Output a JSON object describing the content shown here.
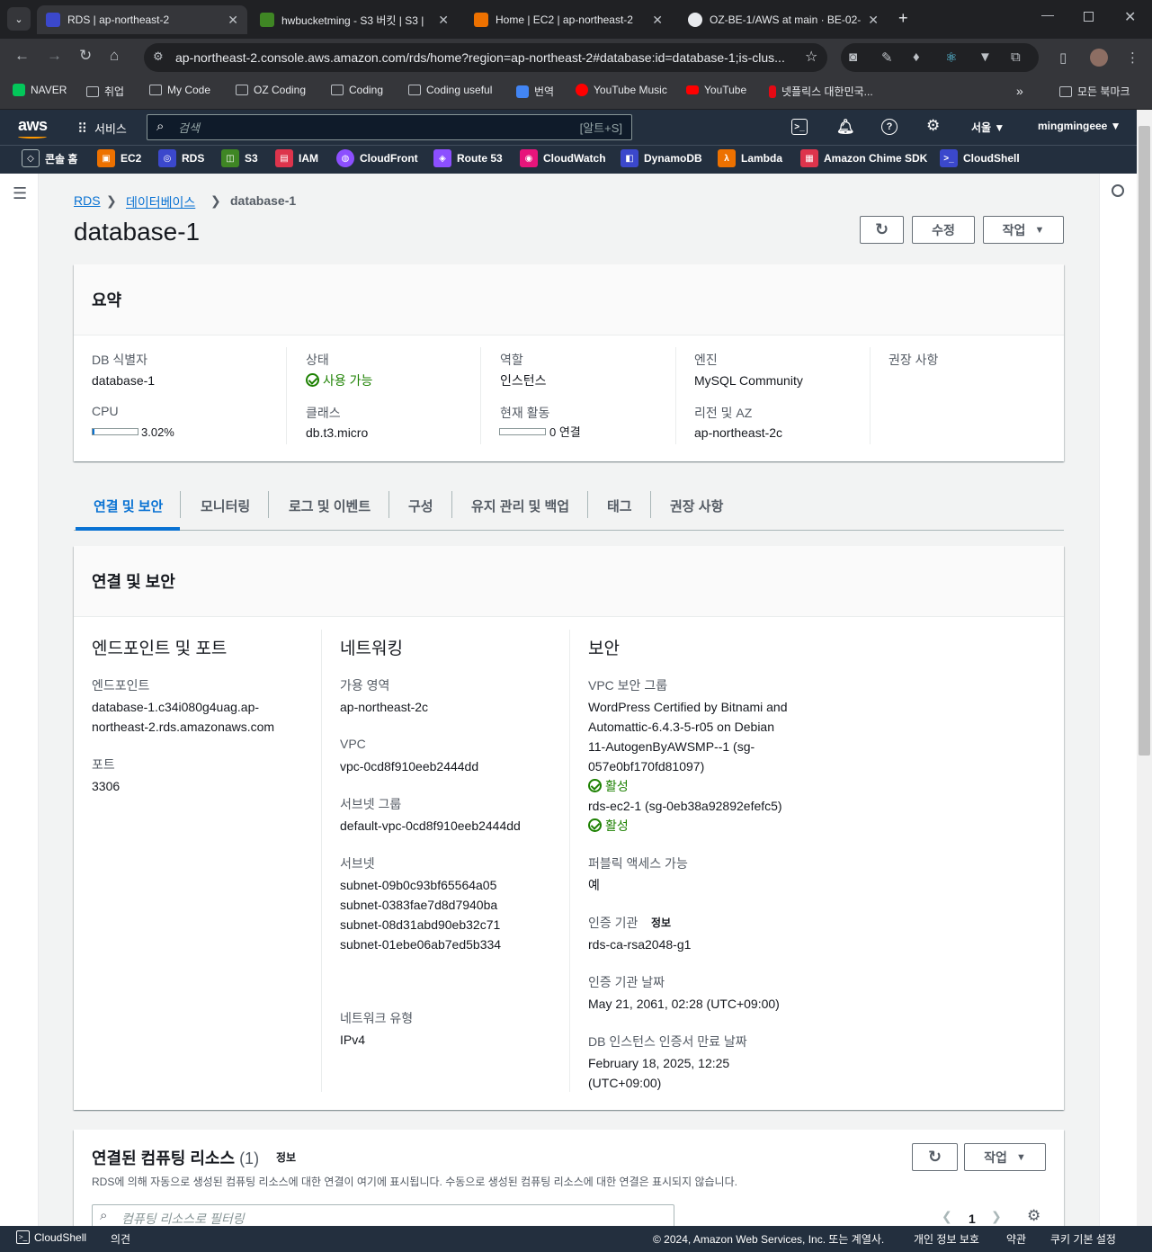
{
  "browser": {
    "tabs": [
      {
        "title": "RDS | ap-northeast-2",
        "active": true,
        "favicon_color": "#3b48cc"
      },
      {
        "title": "hwbucketming - S3 버킷 | S3 |",
        "active": false,
        "favicon_color": "#3f8624"
      },
      {
        "title": "Home | EC2 | ap-northeast-2",
        "active": false,
        "favicon_color": "#ed7100"
      },
      {
        "title": "OZ-BE-1/AWS at main · BE-02-",
        "active": false,
        "favicon_color": "#e8eaed"
      }
    ],
    "url": "ap-northeast-2.console.aws.amazon.com/rds/home?region=ap-northeast-2#database:id=database-1;is-clus...",
    "bookmarks": [
      "NAVER",
      "취업",
      "My Code",
      "OZ Coding",
      "Coding",
      "Coding useful",
      "번역",
      "YouTube Music",
      "YouTube",
      "넷플릭스 대한민국...",
      "모든 북마크"
    ]
  },
  "aws": {
    "services_label": "서비스",
    "search_placeholder": "검색",
    "search_shortcut": "[알트+S]",
    "region": "서울 ▼",
    "user": "mingmingeee ▼",
    "favorites": [
      {
        "label": "콘솔 홈",
        "color": "#232f3e"
      },
      {
        "label": "EC2",
        "color": "#ed7100"
      },
      {
        "label": "RDS",
        "color": "#3b48cc"
      },
      {
        "label": "S3",
        "color": "#3f8624"
      },
      {
        "label": "IAM",
        "color": "#dd344c"
      },
      {
        "label": "CloudFront",
        "color": "#8c4fff"
      },
      {
        "label": "Route 53",
        "color": "#8c4fff"
      },
      {
        "label": "CloudWatch",
        "color": "#e7157b"
      },
      {
        "label": "DynamoDB",
        "color": "#3b48cc"
      },
      {
        "label": "Lambda",
        "color": "#ed7100"
      },
      {
        "label": "Amazon Chime SDK",
        "color": "#dd344c"
      },
      {
        "label": "CloudShell",
        "color": "#3b48cc"
      }
    ]
  },
  "breadcrumb": {
    "root": "RDS",
    "parent": "데이터베이스",
    "current": "database-1"
  },
  "page_title": "database-1",
  "actions": {
    "edit": "수정",
    "actions": "작업"
  },
  "summary": {
    "title": "요약",
    "db_id_label": "DB 식별자",
    "db_id": "database-1",
    "cpu_label": "CPU",
    "cpu": "3.02%",
    "cpu_fraction": 0.0302,
    "status_label": "상태",
    "status": "사용 가능",
    "class_label": "클래스",
    "class": "db.t3.micro",
    "role_label": "역할",
    "role": "인스턴스",
    "activity_label": "현재 활동",
    "activity": "0 연결",
    "activity_fraction": 0,
    "engine_label": "엔진",
    "engine": "MySQL Community",
    "region_label": "리전 및 AZ",
    "region": "ap-northeast-2c",
    "recommend_label": "권장 사항"
  },
  "tabs": [
    "연결 및 보안",
    "모니터링",
    "로그 및 이벤트",
    "구성",
    "유지 관리 및 백업",
    "태그",
    "권장 사항"
  ],
  "conn": {
    "title": "연결 및 보안",
    "endpoint_section": "엔드포인트 및 포트",
    "endpoint_label": "엔드포인트",
    "endpoint_1": "database-1.c34i080g4uag.ap-",
    "endpoint_2": "northeast-2.rds.amazonaws.com",
    "port_label": "포트",
    "port": "3306",
    "network_section": "네트워킹",
    "az_label": "가용 영역",
    "az": "ap-northeast-2c",
    "vpc_label": "VPC",
    "vpc": "vpc-0cd8f910eeb2444dd",
    "subnet_group_label": "서브넷 그룹",
    "subnet_group": "default-vpc-0cd8f910eeb2444dd",
    "subnets_label": "서브넷",
    "subnets": [
      "subnet-09b0c93bf65564a05",
      "subnet-0383fae7d8d7940ba",
      "subnet-08d31abd90eb32c71",
      "subnet-01ebe06ab7ed5b334"
    ],
    "net_type_label": "네트워크 유형",
    "net_type": "IPv4",
    "security_section": "보안",
    "sg_label": "VPC 보안 그룹",
    "sg1": [
      "WordPress Certified by Bitnami and",
      "Automattic-6.4.3-5-r05 on Debian",
      "11-AutogenByAWSMP--1 (sg-",
      "057e0bf170fd81097)"
    ],
    "sg1_status": "활성",
    "sg2": "rds-ec2-1 (sg-0eb38a92892efefc5)",
    "sg2_status": "활성",
    "public_label": "퍼블릭 액세스 가능",
    "public": "예",
    "ca_label": "인증 기관",
    "ca_info": "정보",
    "ca": "rds-ca-rsa2048-g1",
    "ca_date_label": "인증 기관 날짜",
    "ca_date": "May 21, 2061, 02:28 (UTC+09:00)",
    "cert_exp_label": "DB 인스턴스 인증서 만료 날짜",
    "cert_exp_1": "February 18, 2025, 12:25",
    "cert_exp_2": "(UTC+09:00)"
  },
  "compute": {
    "title": "연결된 컴퓨팅 리소스",
    "count": "(1)",
    "info": "정보",
    "desc": "RDS에 의해 자동으로 생성된 컴퓨팅 리소스에 대한 연결이 여기에 표시됩니다. 수동으로 생성된 컴퓨팅 리소스에 대한 연결은 표시되지 않습니다.",
    "filter_placeholder": "컴퓨팅 리소스로 필터링",
    "actions": "작업",
    "page": "1"
  },
  "footer": {
    "cloudshell": "CloudShell",
    "feedback": "의견",
    "copyright": "© 2024, Amazon Web Services, Inc. 또는 계열사.",
    "privacy": "개인 정보 보호",
    "terms": "약관",
    "cookies": "쿠키 기본 설정"
  }
}
